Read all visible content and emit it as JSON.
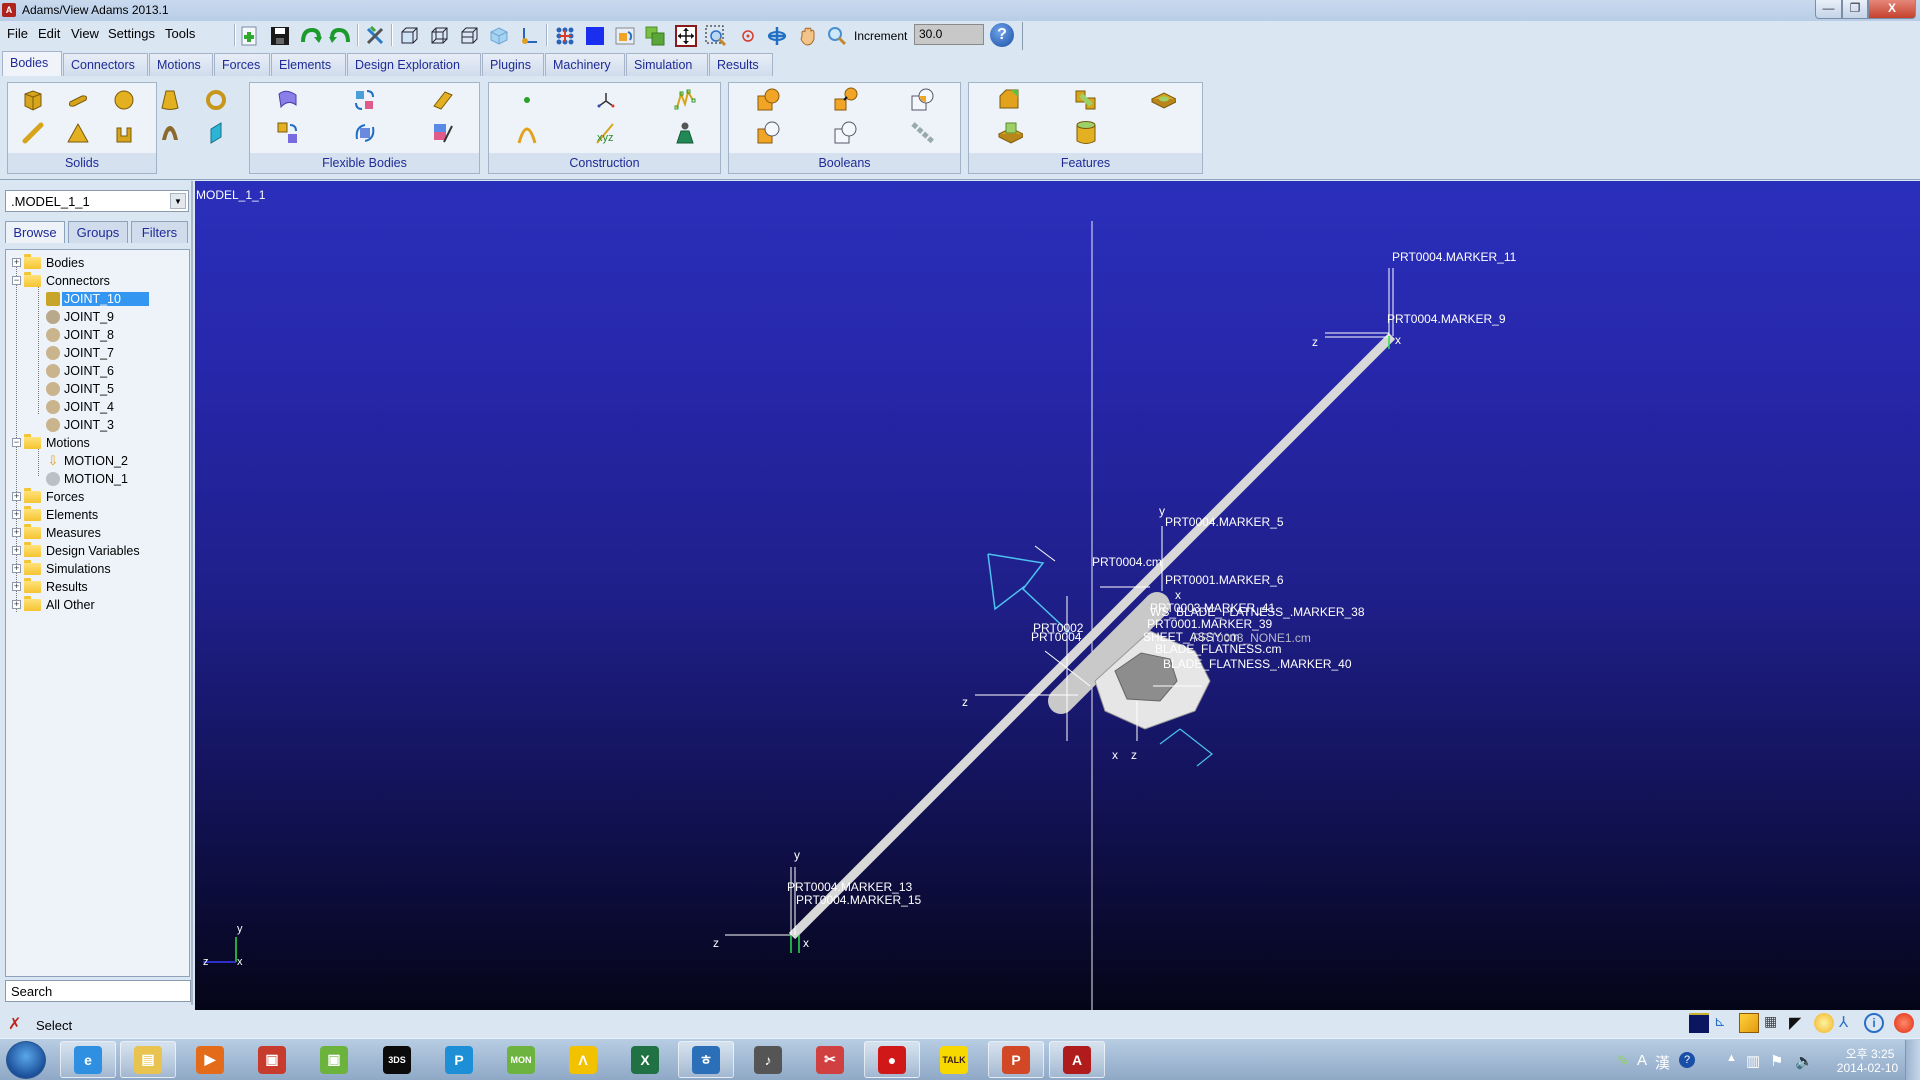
{
  "window": {
    "title": "Adams/View Adams 2013.1",
    "app_icon_letter": "A",
    "minimize": "—",
    "restore": "❐",
    "close": "X"
  },
  "menu": [
    "File",
    "Edit",
    "View",
    "Settings",
    "Tools"
  ],
  "toolbar": {
    "icons": [
      "new-model",
      "save",
      "redo",
      "undo",
      "tools-settings",
      "front-view-box",
      "wireframe-box",
      "side-view-box",
      "iso-render",
      "coordinate-axes",
      "grid-markers",
      "background-color",
      "render-mode",
      "fit-view",
      "zoom-box",
      "center-target",
      "rotate-view",
      "pan-hand",
      "zoom"
    ],
    "increment_label": "Increment",
    "increment_value": "30.0",
    "help": "?"
  },
  "tabs": [
    {
      "label": "Bodies",
      "active": true
    },
    {
      "label": "Connectors"
    },
    {
      "label": "Motions"
    },
    {
      "label": "Forces"
    },
    {
      "label": "Elements"
    },
    {
      "label": "Design Exploration"
    },
    {
      "label": "Plugins"
    },
    {
      "label": "Machinery"
    },
    {
      "label": "Simulation"
    },
    {
      "label": "Results"
    }
  ],
  "ribbon": {
    "groups": [
      {
        "label": "Solids",
        "tools": [
          "box",
          "cylinder",
          "sphere",
          "frustum",
          "torus",
          "link",
          "plate",
          "extrusion",
          "revolution",
          "plane"
        ]
      },
      {
        "label": "Flexible Bodies",
        "tools": [
          "flexible-body-import",
          "rigid-to-flex",
          "discrete-flexible-link",
          "flex-swap",
          "flex-replace",
          "modal-neutral-file"
        ]
      },
      {
        "label": "Construction",
        "tools": [
          "point",
          "marker",
          "polyline",
          "arc",
          "spline",
          "dummy-body"
        ]
      },
      {
        "label": "Booleans",
        "tools": [
          "union",
          "merge",
          "intersect",
          "cut",
          "split",
          "chain"
        ]
      },
      {
        "label": "Features",
        "tools": [
          "chamfer",
          "fillet-hole",
          "boss",
          "hole",
          "hollow"
        ]
      }
    ]
  },
  "browser": {
    "model": ".MODEL_1_1",
    "tabs": [
      "Browse",
      "Groups",
      "Filters"
    ],
    "tree": [
      {
        "label": "Bodies",
        "type": "folder",
        "expanded": false
      },
      {
        "label": "Connectors",
        "type": "folder",
        "expanded": true
      },
      {
        "label": "JOINT_10",
        "type": "joint",
        "selected": true
      },
      {
        "label": "JOINT_9",
        "type": "joint"
      },
      {
        "label": "JOINT_8",
        "type": "joint"
      },
      {
        "label": "JOINT_7",
        "type": "joint"
      },
      {
        "label": "JOINT_6",
        "type": "joint"
      },
      {
        "label": "JOINT_5",
        "type": "joint"
      },
      {
        "label": "JOINT_4",
        "type": "joint"
      },
      {
        "label": "JOINT_3",
        "type": "joint"
      },
      {
        "label": "Motions",
        "type": "folder",
        "expanded": true
      },
      {
        "label": "MOTION_2",
        "type": "motion"
      },
      {
        "label": "MOTION_1",
        "type": "motion"
      },
      {
        "label": "Forces",
        "type": "folder",
        "expanded": false
      },
      {
        "label": "Elements",
        "type": "folder",
        "expanded": false
      },
      {
        "label": "Measures",
        "type": "folder",
        "expanded": false
      },
      {
        "label": "Design Variables",
        "type": "folder",
        "expanded": false
      },
      {
        "label": "Simulations",
        "type": "folder",
        "expanded": false
      },
      {
        "label": "Results",
        "type": "folder",
        "expanded": false
      },
      {
        "label": "All Other",
        "type": "folder",
        "expanded": false
      }
    ],
    "search_placeholder": "Search"
  },
  "viewport": {
    "model_label": "MODEL_1_1",
    "labels": {
      "marker_11": "PRT0004.MARKER_11",
      "marker_9": "PRT0004.MARKER_9",
      "marker_5": "PRT0004.MARKER_5",
      "cm4": "PRT0004.cm",
      "marker_6": "PRT0001.MARKER_6",
      "marker_41": "PRT0003.MARKER_41",
      "marker_38": "WS_BLADE_FLATNESS_.MARKER_38",
      "marker_39": "PRT0001.MARKER_39",
      "sheet_cm": "SHEET_ASSY.cm",
      "none1_cm": "PRT0003_NONE1.cm",
      "flatness_cm": "BLADE_FLATNESS.cm",
      "marker_40": "BLADE_FLATNESS_.MARKER_40",
      "prt0002": "PRT0002",
      "prt0004b": "PRT0004",
      "marker_13": "PRT0004.MARKER_13",
      "marker_15": "PRT0004.MARKER_15"
    },
    "axis_letters": {
      "x": "x",
      "y": "y",
      "z": "z"
    },
    "triad": {
      "x": "x",
      "y": "y",
      "z": "z"
    }
  },
  "status": {
    "text": "Select",
    "icons": [
      "background-color",
      "coordinate-window",
      "render-color",
      "grid-toggle",
      "shading",
      "lighting-globe",
      "triad-toggle",
      "info",
      "stop"
    ]
  },
  "taskbar": {
    "apps": [
      {
        "name": "internet-explorer",
        "glyph": "e",
        "color": "#2f8fe0",
        "open": true
      },
      {
        "name": "file-explorer",
        "glyph": "▤",
        "color": "#e8c34f",
        "open": true
      },
      {
        "name": "media-player",
        "glyph": "▶",
        "color": "#e36b1a"
      },
      {
        "name": "adams-view-red",
        "glyph": "▣",
        "color": "#c73a2e"
      },
      {
        "name": "adams-view-green",
        "glyph": "▣",
        "color": "#6cb33e"
      },
      {
        "name": "catia",
        "glyph": "3DS",
        "color": "#0b0b0b"
      },
      {
        "name": "pdf-tool",
        "glyph": "P",
        "color": "#1d8fd6"
      },
      {
        "name": "mon-app",
        "glyph": "MON",
        "color": "#6db33f"
      },
      {
        "name": "alyac",
        "glyph": "Λ",
        "color": "#f2c100"
      },
      {
        "name": "excel",
        "glyph": "X",
        "color": "#207245"
      },
      {
        "name": "hangul",
        "glyph": "ㅎ",
        "color": "#2a6fb8",
        "open": true
      },
      {
        "name": "music-player",
        "glyph": "♪",
        "color": "#555"
      },
      {
        "name": "snipping-tool",
        "glyph": "✂",
        "color": "#d04040"
      },
      {
        "name": "recorder",
        "glyph": "●",
        "color": "#d01818",
        "open": true
      },
      {
        "name": "kakaotalk",
        "glyph": "TALK",
        "color": "#f7d900"
      },
      {
        "name": "powerpoint",
        "glyph": "P",
        "color": "#d24726",
        "open": true
      },
      {
        "name": "adams",
        "glyph": "A",
        "color": "#b01c1c",
        "open": true
      }
    ],
    "tray": [
      "ime-icon",
      "A",
      "漢",
      "?",
      "network",
      "flag",
      "volume"
    ],
    "clock_time": "오후 3:25",
    "clock_date": "2014-02-10"
  }
}
